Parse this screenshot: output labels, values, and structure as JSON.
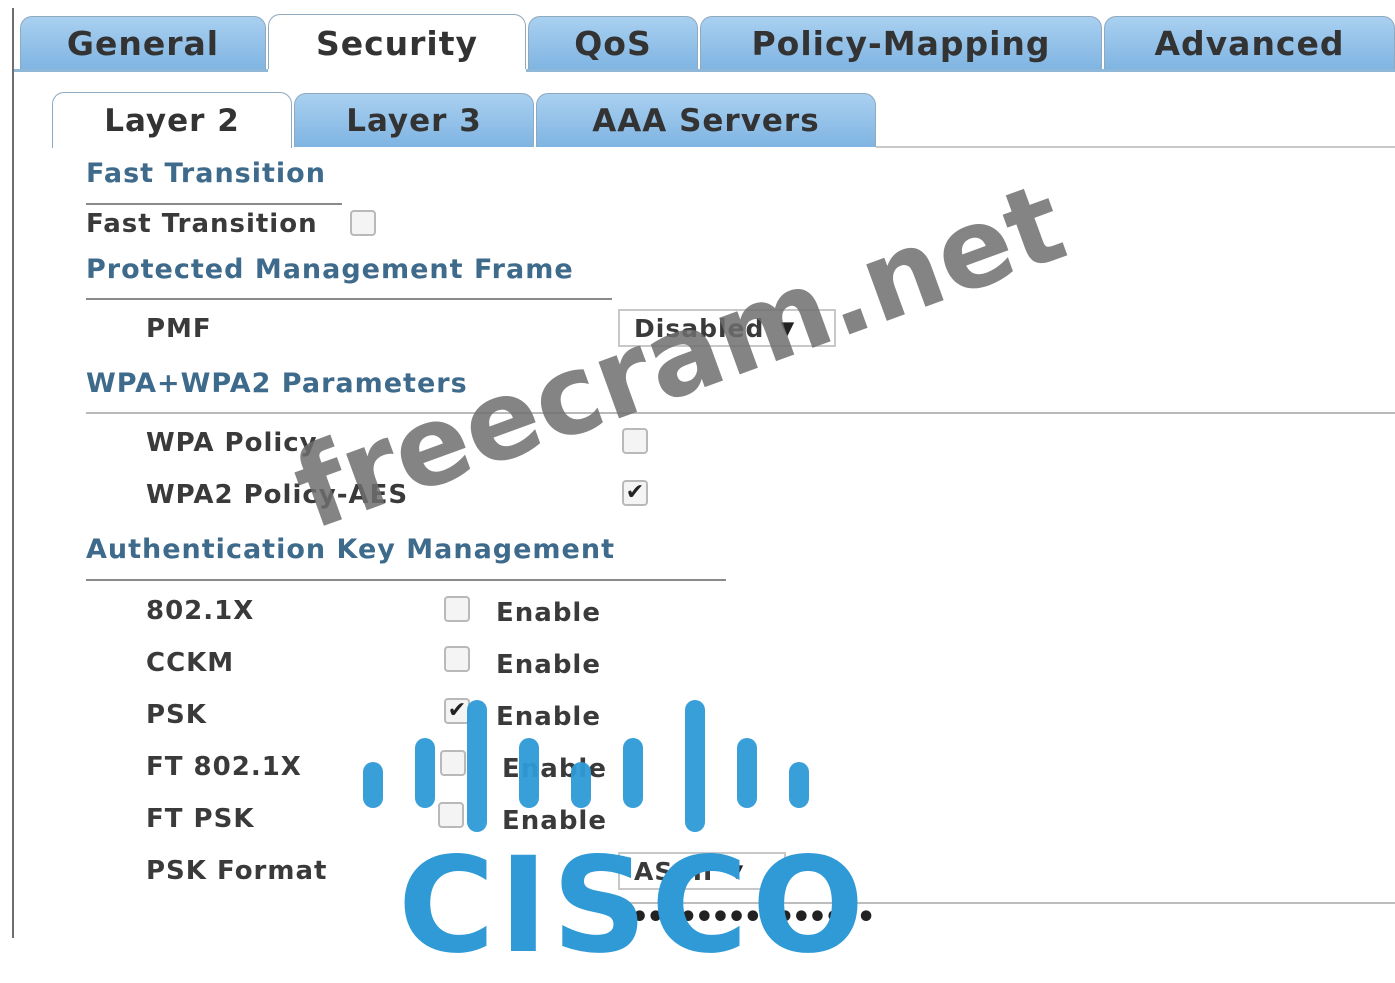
{
  "main_tabs": [
    "General",
    "Security",
    "QoS",
    "Policy-Mapping",
    "Advanced"
  ],
  "active_main_tab": "Security",
  "sub_tabs": [
    "Layer 2",
    "Layer 3",
    "AAA Servers"
  ],
  "active_sub_tab": "Layer 2",
  "fast_transition": {
    "section_title": "Fast Transition",
    "label": "Fast Transition",
    "checked": false
  },
  "pmf": {
    "section_title": "Protected Management Frame",
    "label": "PMF",
    "value": "Disabled"
  },
  "wpa": {
    "section_title": "WPA+WPA2 Parameters",
    "wpa_policy_label": "WPA Policy",
    "wpa_policy_checked": false,
    "wpa2_aes_label": "WPA2 Policy-AES",
    "wpa2_aes_checked": true
  },
  "akm": {
    "section_title": "Authentication Key Management",
    "enable_text": "Enable",
    "rows": [
      {
        "label": "802.1X",
        "checked": false
      },
      {
        "label": "CCKM",
        "checked": false
      },
      {
        "label": "PSK",
        "checked": true
      },
      {
        "label": "FT 802.1X",
        "checked": false
      },
      {
        "label": "FT PSK",
        "checked": false
      }
    ],
    "psk_format_label": "PSK Format",
    "psk_format_value": "ASCII",
    "psk_value": "•••••••••••••••"
  },
  "watermark": "freecram.net",
  "logo_text": "CISCO",
  "colors": {
    "tab_blue": "#7fb4e2",
    "section_title": "#3e6a8c",
    "cisco_blue": "#2f9ad6"
  }
}
